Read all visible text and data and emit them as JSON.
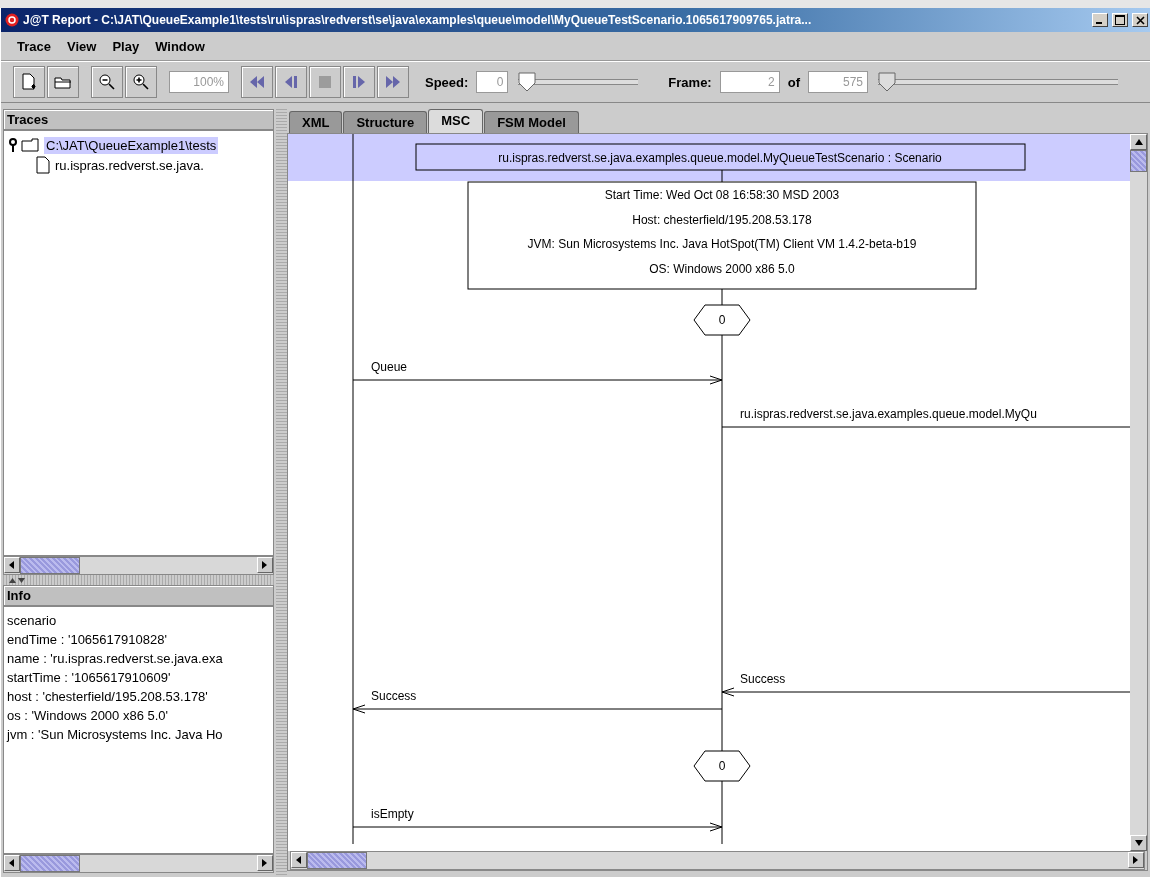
{
  "window": {
    "title": "J@T Report - C:\\JAT\\QueueExample1\\tests\\ru\\ispras\\redverst\\se\\java\\examples\\queue\\model\\MyQueueTestScenario.1065617909765.jatra..."
  },
  "menu": [
    "Trace",
    "View",
    "Play",
    "Window"
  ],
  "toolbar": {
    "buttons": [
      {
        "kind": "new",
        "disabled": false
      },
      {
        "kind": "open",
        "disabled": false
      },
      {
        "kind": "zoom-out",
        "disabled": false
      },
      {
        "kind": "zoom-in",
        "disabled": false
      },
      {
        "kind": "zoom-field",
        "value": "100%"
      },
      {
        "kind": "rewind",
        "disabled": false
      },
      {
        "kind": "step-back",
        "disabled": false
      },
      {
        "kind": "stop",
        "disabled": true
      },
      {
        "kind": "step-forward",
        "disabled": false
      },
      {
        "kind": "fast-forward",
        "disabled": false
      }
    ],
    "speed_label": "Speed:",
    "speed": "0",
    "speed_slider": {
      "level": 0
    },
    "frame_label": "Frame:",
    "frame": "2",
    "of_label": "of",
    "frame_total": "575",
    "frame_slider": {
      "level": 0
    }
  },
  "traces": {
    "title": "Traces",
    "tree": [
      {
        "label": "C:\\JAT\\QueueExample1\\tests",
        "selected": true,
        "expanded": true,
        "children": [
          {
            "label": "ru.ispras.redverst.se.java.",
            "selected": false
          }
        ]
      }
    ]
  },
  "info": {
    "title": "Info",
    "lines": [
      "scenario",
      "endTime : '1065617910828'",
      "name : 'ru.ispras.redverst.se.java.exa",
      "startTime : '1065617910609'",
      "host : 'chesterfield/195.208.53.178'",
      "os : 'Windows 2000 x86 5.0'",
      "jvm : 'Sun Microsystems Inc. Java Ho"
    ]
  },
  "tabs": [
    {
      "label": "XML",
      "selected": false
    },
    {
      "label": "Structure",
      "selected": false
    },
    {
      "label": "MSC",
      "selected": true
    },
    {
      "label": "FSM Model",
      "selected": false
    }
  ],
  "msc": {
    "scenario": "ru.ispras.redverst.se.java.examples.queue.model.MyQueueTestScenario : Scenario",
    "details": [
      "Start Time: Wed Oct 08 16:58:30 MSD 2003",
      "Host: chesterfield/195.208.53.178",
      "JVM: Sun Microsystems Inc. Java HotSpot(TM) Client VM 1.4.2-beta-b19",
      "OS: Windows 2000 x86 5.0"
    ],
    "elements": [
      {
        "kind": "condition",
        "label": "0"
      },
      {
        "kind": "request",
        "label": "Queue"
      },
      {
        "kind": "forward",
        "label": "ru.ispras.redverst.se.java.examples.queue.model.MyQu"
      },
      {
        "kind": "reply",
        "label": "Success"
      },
      {
        "kind": "return",
        "label": "Success"
      },
      {
        "kind": "condition",
        "label": "0"
      },
      {
        "kind": "request",
        "label": "isEmpty"
      }
    ]
  }
}
